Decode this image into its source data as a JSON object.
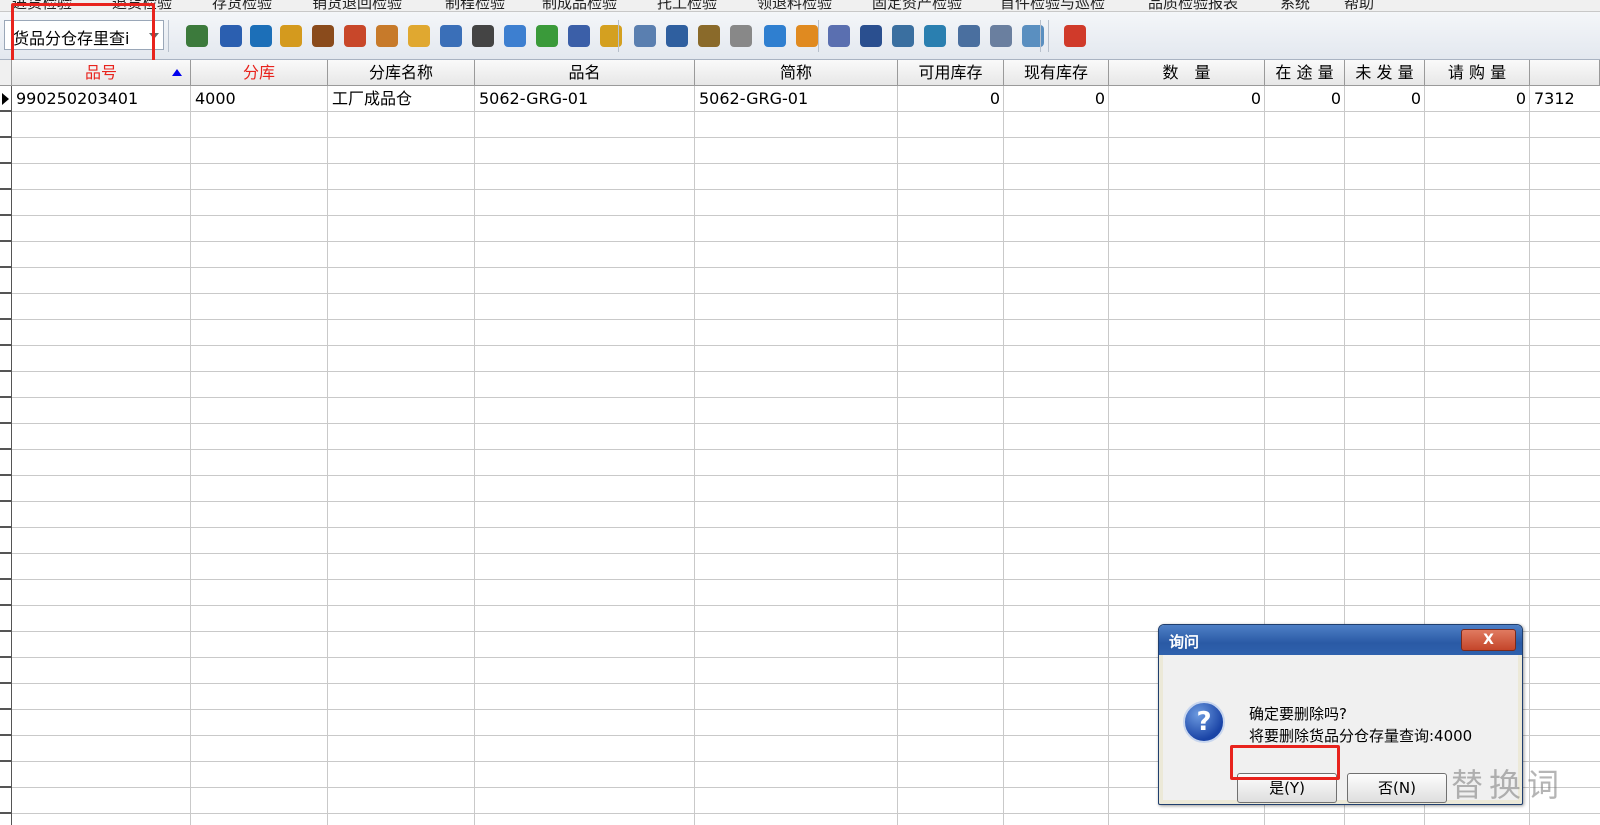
{
  "menu": {
    "items": [
      "进货检验",
      "退货检验",
      "存货检验",
      "销货退回检验",
      "制程检验",
      "制成品检验",
      "托工检验",
      "领退料检验",
      "固定资产检验",
      "首件检验与巡检",
      "品质检验报表",
      "系统",
      "帮助"
    ]
  },
  "toolbar": {
    "combo_value": "货品分仓存里查i",
    "icons": [
      "switch-icon",
      "monitor-icon",
      "refresh-icon",
      "lock-icon",
      "briefcase-icon",
      "home-icon",
      "people-icon",
      "mail-icon",
      "book-icon",
      "key-icon",
      "help-icon",
      "money-icon",
      "cart-icon",
      "cash-icon",
      "report-icon",
      "document-icon",
      "database-icon",
      "copy-icon",
      "check-icon",
      "bell-icon",
      "search-doc-icon",
      "tree-icon",
      "screen-icon",
      "cycle-icon",
      "window-icon",
      "close-window-icon",
      "cascade-icon",
      "exit-icon"
    ]
  },
  "grid": {
    "columns": [
      {
        "label": "品号",
        "red": true,
        "sorted": true
      },
      {
        "label": "分库",
        "red": true
      },
      {
        "label": "分库名称"
      },
      {
        "label": "品名"
      },
      {
        "label": "简称"
      },
      {
        "label": "可用库存"
      },
      {
        "label": "现有库存"
      },
      {
        "label": "数　量"
      },
      {
        "label": "在 途 量"
      },
      {
        "label": "未 发 量"
      },
      {
        "label": "请 购 量"
      },
      {
        "label": ""
      }
    ],
    "rows": [
      [
        "990250203401",
        "4000",
        "工厂成品仓",
        "5062-GRG-01",
        "5062-GRG-01",
        "0",
        "0",
        "0",
        "0",
        "0",
        "0",
        "7312"
      ]
    ]
  },
  "dialog": {
    "title": "询问",
    "close": "X",
    "message1": "确定要删除吗?",
    "message2": "将要删除货品分仓存量查询:4000",
    "yes": "是(Y)",
    "no": "否(N)"
  },
  "watermark": "替换词"
}
